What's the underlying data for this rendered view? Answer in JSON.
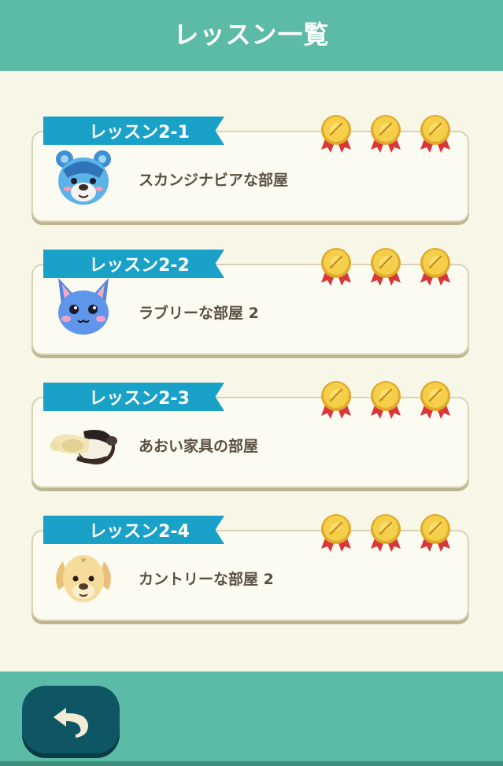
{
  "header": {
    "title": "レッスン一覧"
  },
  "lessons": [
    {
      "label": "レッスン2-1",
      "room": "スカンジナビアな部屋",
      "medals": 3,
      "avatar_icon": "blue-bear-villager-icon"
    },
    {
      "label": "レッスン2-2",
      "room": "ラブリーな部屋 2",
      "medals": 3,
      "avatar_icon": "blue-cat-villager-icon"
    },
    {
      "label": "レッスン2-3",
      "room": "あおい家具の部屋",
      "medals": 3,
      "avatar_icon": "anteater-villager-icon"
    },
    {
      "label": "レッスン2-4",
      "room": "カントリーな部屋 2",
      "medals": 3,
      "avatar_icon": "yellow-dog-villager-icon"
    }
  ],
  "footer": {
    "back_icon": "back-arrow-icon"
  },
  "colors": {
    "header_bg": "#5bbba6",
    "ribbon": "#1aa1c8",
    "medal_gold": "#f2c53d",
    "medal_ribbon": "#d9383a",
    "back_button": "#0f5664",
    "page_bg": "#f8f6e6"
  }
}
